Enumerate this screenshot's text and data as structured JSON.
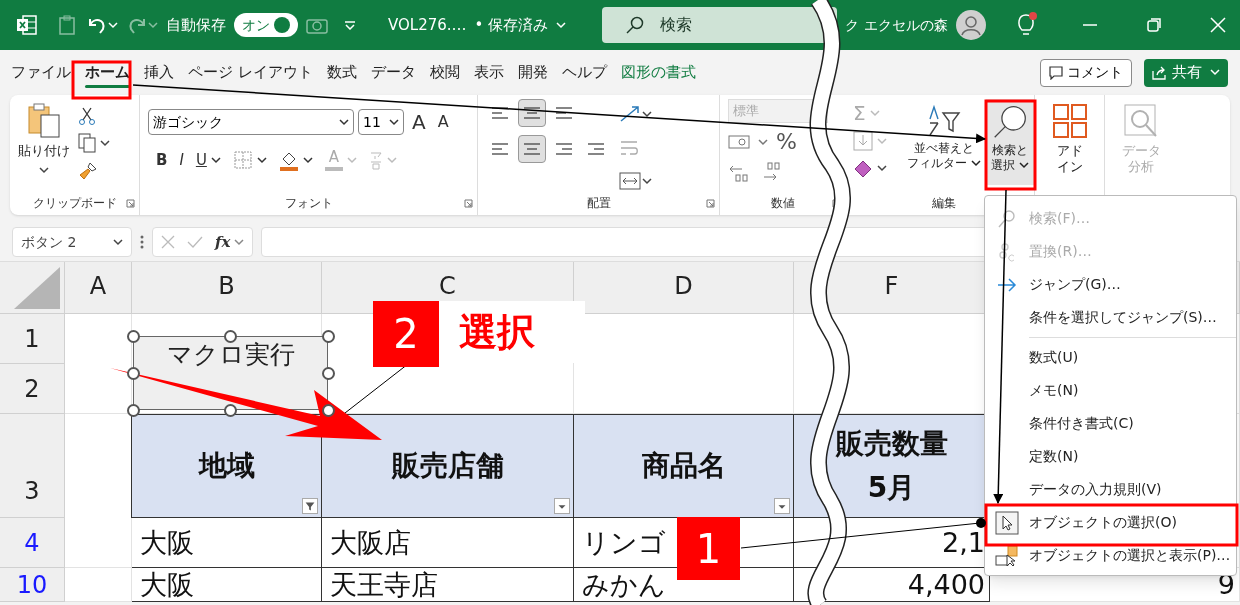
{
  "title_bar": {
    "autosave_label": "自動保存",
    "autosave_toggle": {
      "label": "オン",
      "on": true
    },
    "file_name": "VOL276.…",
    "save_status": "• 保存済み",
    "search_placeholder": "検索",
    "user_name": "ク エクセルの森"
  },
  "menu_tabs": [
    {
      "label": "ファイル",
      "selected": false,
      "kind": "standard"
    },
    {
      "label": "ホーム",
      "selected": true,
      "kind": "standard"
    },
    {
      "label": "挿入",
      "selected": false,
      "kind": "standard"
    },
    {
      "label": "ページ レイアウト",
      "selected": false,
      "kind": "standard"
    },
    {
      "label": "数式",
      "selected": false,
      "kind": "standard"
    },
    {
      "label": "データ",
      "selected": false,
      "kind": "standard"
    },
    {
      "label": "校閲",
      "selected": false,
      "kind": "standard"
    },
    {
      "label": "表示",
      "selected": false,
      "kind": "standard"
    },
    {
      "label": "開発",
      "selected": false,
      "kind": "standard"
    },
    {
      "label": "ヘルプ",
      "selected": false,
      "kind": "standard"
    },
    {
      "label": "図形の書式",
      "selected": false,
      "kind": "contextual"
    }
  ],
  "comment_button": "コメント",
  "share_button": "共有",
  "ribbon": {
    "clipboard": {
      "label": "クリップボード",
      "paste": "貼り付け"
    },
    "font": {
      "label": "フォント",
      "font_name": "游ゴシック",
      "font_size": "11",
      "grow": "A",
      "shrink": "A",
      "bold": "B",
      "italic": "I",
      "underline": "U",
      "font_color": "A"
    },
    "alignment": {
      "label": "配置"
    },
    "number": {
      "label": "数値",
      "format": "標準",
      "percent": "%"
    },
    "editing": {
      "label": "編集",
      "autosum": "Σ",
      "sort_filter": [
        "並べ替えと",
        "フィルター"
      ],
      "find_select": [
        "検索と",
        "選択"
      ]
    },
    "addins": [
      "アド",
      "イン"
    ],
    "data_analysis": {
      "lines": [
        "データ",
        "分析"
      ],
      "disabled": true
    }
  },
  "formula_bar": {
    "name_box": "ボタン 2",
    "function_label": "fx"
  },
  "columns": [
    "A",
    "B",
    "C",
    "D",
    "F"
  ],
  "rows": [
    {
      "number": "1",
      "filtered": false
    },
    {
      "number": "2",
      "filtered": false
    },
    {
      "number": "3",
      "filtered": false
    },
    {
      "number": "4",
      "filtered": true
    },
    {
      "number": "10",
      "filtered": true
    }
  ],
  "table_header": [
    {
      "lines": [
        "地域"
      ],
      "kind": "filtered"
    },
    {
      "lines": [
        "販売店舗"
      ],
      "kind": "filterable"
    },
    {
      "lines": [
        "商品名"
      ],
      "kind": "filterable"
    },
    {
      "lines": [
        "販売数量",
        "5月"
      ],
      "kind": "plain"
    }
  ],
  "table_rows": [
    [
      "大阪",
      "大阪店",
      "リンゴ",
      "2,1"
    ],
    [
      "大阪",
      "天王寺店",
      "みかん",
      "4,400",
      "9"
    ]
  ],
  "shape_button": {
    "label": "マクロ実行",
    "selected": true
  },
  "dropdown_menu": [
    {
      "label": "検索(F)…",
      "kind": "search",
      "disabled": true
    },
    {
      "label": "置換(R)…",
      "kind": "replace",
      "disabled": true
    },
    {
      "label": "ジャンプ(G)…",
      "kind": "goto",
      "disabled": false
    },
    {
      "label": "条件を選択してジャンプ(S)…",
      "kind": "plain",
      "disabled": false
    },
    {
      "label": "数式(U)",
      "kind": "plain",
      "disabled": false
    },
    {
      "label": "メモ(N)",
      "kind": "plain",
      "disabled": false
    },
    {
      "label": "条件付き書式(C)",
      "kind": "plain",
      "disabled": false
    },
    {
      "label": "定数(N)",
      "kind": "plain",
      "disabled": false
    },
    {
      "label": "データの入力規則(V)",
      "kind": "plain",
      "disabled": false
    },
    {
      "label": "オブジェクトの選択(O)",
      "kind": "pointer",
      "disabled": false
    },
    {
      "label": "オブジェクトの選択と表示(P)…",
      "kind": "pane",
      "disabled": false
    }
  ],
  "callouts": [
    {
      "number": "1"
    },
    {
      "number": "2",
      "caption": "選択"
    }
  ]
}
